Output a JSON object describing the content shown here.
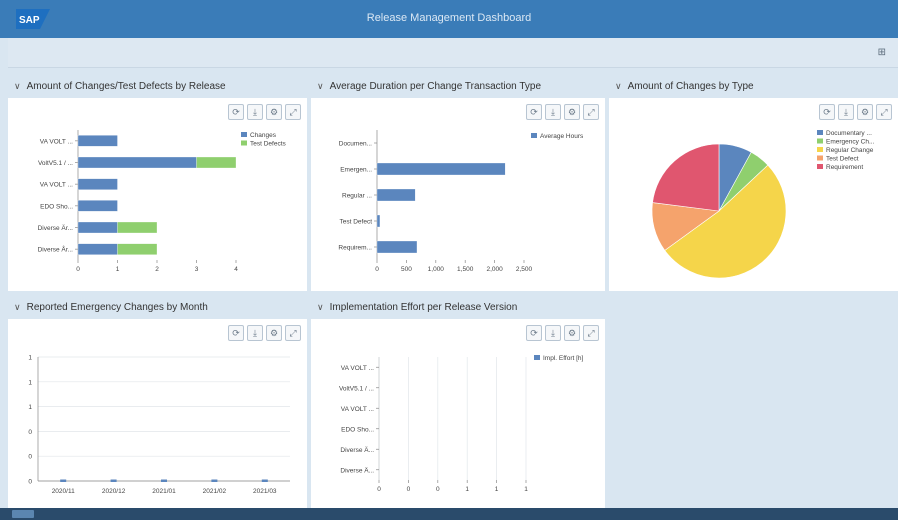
{
  "shell": {
    "title": "Release Management Dashboard",
    "logo": "SAP"
  },
  "subheader": {
    "icon": "grid-icon",
    "icon_glyph": "⊞"
  },
  "toolbar_icons": [
    "refresh-icon",
    "download-icon",
    "settings-icon",
    "fullscreen-icon"
  ],
  "toolbar_glyphs": [
    "⟳",
    "⤓",
    "⚙",
    "⤢"
  ],
  "cards": {
    "changes_by_release": {
      "title": "Amount of Changes/Test Defects by Release",
      "chart_data": {
        "type": "bar",
        "orientation": "horizontal",
        "stacked": true,
        "categories": [
          "VA VOLT ...",
          "VoltV5.1 / ...",
          "VA VOLT ...",
          "EDO Sho...",
          "Diverse Är...",
          "Diverse År..."
        ],
        "series": [
          {
            "name": "Changes",
            "color": "#5b86be",
            "values": [
              1,
              3,
              1,
              1,
              1,
              1
            ]
          },
          {
            "name": "Test Defects",
            "color": "#8fcf6e",
            "values": [
              0,
              1,
              0,
              0,
              1,
              1
            ]
          }
        ],
        "xticks": [
          "0",
          "1",
          "2",
          "3",
          "4"
        ],
        "xlim": [
          0,
          4
        ]
      }
    },
    "avg_duration": {
      "title": "Average Duration per Change Transaction Type",
      "chart_data": {
        "type": "bar",
        "orientation": "horizontal",
        "categories": [
          "Documen...",
          "Emergen...",
          "Regular ...",
          "Test Defect",
          "Requirem..."
        ],
        "series": [
          {
            "name": "Average Hours",
            "color": "#5b86be",
            "values": [
              0,
              2180,
              650,
              50,
              680
            ]
          }
        ],
        "xticks": [
          "0",
          "500",
          "1,000",
          "1,500",
          "2,000",
          "2,500"
        ],
        "xlim": [
          0,
          2500
        ]
      }
    },
    "changes_by_type": {
      "title": "Amount of Changes by Type",
      "chart_data": {
        "type": "pie",
        "categories": [
          "Documentary ...",
          "Emergency Ch...",
          "Regular Change",
          "Test Defect",
          "Requirement"
        ],
        "values": [
          8,
          5,
          52,
          12,
          23
        ],
        "colors": [
          "#5b86be",
          "#8fcf6e",
          "#f5d54a",
          "#f5a36c",
          "#e0566f"
        ]
      }
    },
    "emergency_by_month": {
      "title": "Reported Emergency Changes by Month",
      "chart_data": {
        "type": "line",
        "categories": [
          "2020/11",
          "2020/12",
          "2021/01",
          "2021/02",
          "2021/03"
        ],
        "series": [
          {
            "color": "#5b86be",
            "values": [
              0,
              0,
              0,
              0,
              0
            ]
          }
        ],
        "yticks": [
          "0",
          "0",
          "0",
          "1",
          "1",
          "1"
        ],
        "ylim": [
          0,
          1
        ]
      }
    },
    "impl_effort": {
      "title": "Implementation Effort per Release Version",
      "chart_data": {
        "type": "bar",
        "orientation": "horizontal",
        "categories": [
          "VA VOLT ...",
          "VoltV5.1 / ...",
          "VA VOLT ...",
          "EDO Sho...",
          "Diverse Ä...",
          "Diverse Ä..."
        ],
        "series": [
          {
            "name": "Impl. Effort [h]",
            "color": "#5b86be",
            "values": [
              0,
              0,
              0,
              0,
              0,
              0
            ]
          }
        ],
        "xticks": [
          "0",
          "0",
          "0",
          "1",
          "1",
          "1"
        ],
        "xlim": [
          0,
          1
        ]
      }
    }
  }
}
